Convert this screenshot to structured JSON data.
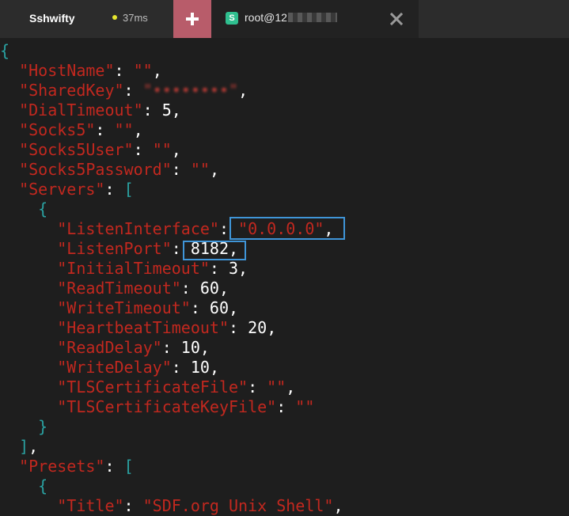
{
  "app": {
    "brand": "Sshwifty",
    "latency": "37ms"
  },
  "tab": {
    "badge": "S",
    "title": "root@12",
    "close_icon": "close-icon",
    "add_icon": "plus-icon"
  },
  "config": {
    "open_brace": "{",
    "close_brace": "}",
    "hostname_key": "\"HostName\"",
    "hostname_value": "\"\"",
    "sharedkey_key": "\"SharedKey\"",
    "sharedkey_value": "\"••••••••\"",
    "dialtimeout_key": "\"DialTimeout\"",
    "dialtimeout_value": "5",
    "socks5_key": "\"Socks5\"",
    "socks5_value": "\"\"",
    "socks5user_key": "\"Socks5User\"",
    "socks5user_value": "\"\"",
    "socks5password_key": "\"Socks5Password\"",
    "socks5password_value": "\"\"",
    "servers_key": "\"Servers\"",
    "listeninterface_key": "\"ListenInterface\"",
    "listeninterface_value": "\"0.0.0.0\"",
    "listenport_key": "\"ListenPort\"",
    "listenport_value": "8182",
    "initialtimeout_key": "\"InitialTimeout\"",
    "initialtimeout_value": "3",
    "readtimeout_key": "\"ReadTimeout\"",
    "readtimeout_value": "60",
    "writetimeout_key": "\"WriteTimeout\"",
    "writetimeout_value": "60",
    "heartbeattimeout_key": "\"HeartbeatTimeout\"",
    "heartbeattimeout_value": "20",
    "readdelay_key": "\"ReadDelay\"",
    "readdelay_value": "10",
    "writedelay_key": "\"WriteDelay\"",
    "writedelay_value": "10",
    "tlscertfile_key": "\"TLSCertificateFile\"",
    "tlscertfile_value": "\"\"",
    "tlscertkeyfile_key": "\"TLSCertificateKeyFile\"",
    "tlscertkeyfile_value": "\"\"",
    "presets_key": "\"Presets\"",
    "title_key": "\"Title\"",
    "title_value": "\"SDF.org Unix Shell\""
  },
  "colors": {
    "key": "#c2281f",
    "bracket": "#2aa2a2",
    "highlight_box": "#3f95d8",
    "add_tab_bg": "#b85c6a",
    "tab_badge_bg": "#2fbf8f"
  }
}
